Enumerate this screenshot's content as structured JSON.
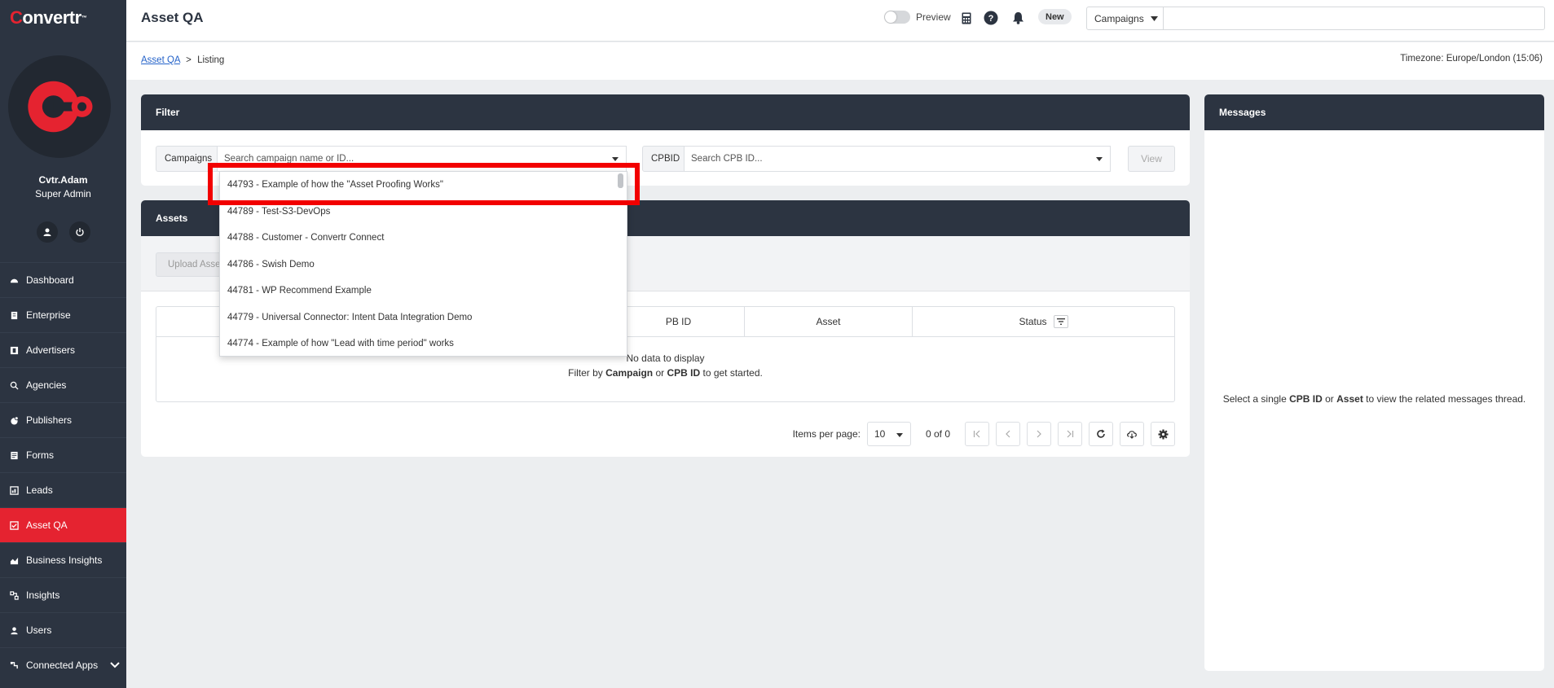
{
  "brand": {
    "name": "onvertr",
    "mark": "C",
    "tm": "™"
  },
  "user": {
    "name": "Cvtr.Adam",
    "role": "Super Admin"
  },
  "nav": [
    {
      "label": "Dashboard",
      "icon": "dashboard-icon"
    },
    {
      "label": "Enterprise",
      "icon": "enterprise-icon"
    },
    {
      "label": "Advertisers",
      "icon": "advertisers-icon"
    },
    {
      "label": "Agencies",
      "icon": "agencies-icon"
    },
    {
      "label": "Publishers",
      "icon": "publishers-icon"
    },
    {
      "label": "Forms",
      "icon": "forms-icon"
    },
    {
      "label": "Leads",
      "icon": "leads-icon"
    },
    {
      "label": "Asset QA",
      "icon": "asset-qa-icon",
      "active": true
    },
    {
      "label": "Business Insights",
      "icon": "business-insights-icon"
    },
    {
      "label": "Insights",
      "icon": "insights-icon"
    },
    {
      "label": "Users",
      "icon": "users-icon"
    },
    {
      "label": "Connected Apps",
      "icon": "connected-apps-icon"
    }
  ],
  "header": {
    "title": "Asset QA",
    "preview_label": "Preview",
    "new_label": "New",
    "campaign_select": "Campaigns"
  },
  "breadcrumb": {
    "root": "Asset QA",
    "sep": ">",
    "current": "Listing"
  },
  "timezone": "Timezone: Europe/London (15:06)",
  "filter": {
    "title": "Filter",
    "campaigns_label": "Campaigns",
    "campaigns_placeholder": "Search campaign name or ID...",
    "cpbid_label": "CPBID",
    "cpbid_placeholder": "Search CPB ID...",
    "view_label": "View"
  },
  "assets": {
    "title": "Assets",
    "upload_label": "Upload Asset",
    "columns": [
      "PB ID",
      "Asset",
      "Status"
    ],
    "empty_line1": "No data to display",
    "empty_pre": "Filter by ",
    "empty_campaign": "Campaign",
    "empty_or": " or ",
    "empty_cpb": "CPB ID",
    "empty_post": " to get started.",
    "items_per_page_label": "Items per page:",
    "items_per_page": "10",
    "range": "0 of 0"
  },
  "messages": {
    "title": "Messages",
    "pre": "Select a single ",
    "cpb": "CPB ID",
    "or": " or ",
    "asset": "Asset",
    "post": " to view the related messages thread."
  },
  "dropdown": [
    "44793 - Example of how the \"Asset Proofing Works\"",
    "44789 - Test-S3-DevOps",
    "44788 - Customer - Convertr Connect",
    "44786 - Swish Demo",
    "44781 - WP Recommend Example",
    "44779 - Universal Connector: Intent Data Integration Demo",
    "44774 - Example of how \"Lead with time period\" works"
  ],
  "colors": {
    "sidebar": "#2c3441",
    "accent": "#e52330",
    "highlight": "#f20000"
  }
}
